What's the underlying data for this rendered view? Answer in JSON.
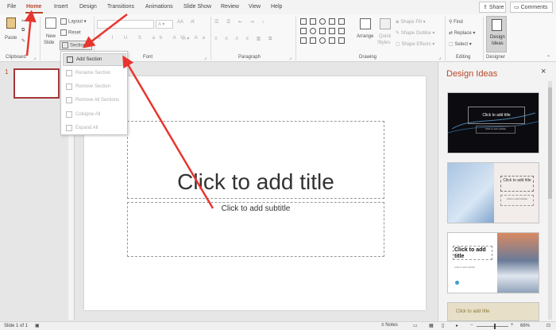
{
  "tabs": [
    "File",
    "Home",
    "Insert",
    "Design",
    "Transitions",
    "Animations",
    "Slide Show",
    "Review",
    "View",
    "Help"
  ],
  "header": {
    "share_label": "Share",
    "comments_label": "Comments"
  },
  "ribbon": {
    "clipboard": {
      "paste": "Paste",
      "label": "Clipboard"
    },
    "slides": {
      "new_slide": "New",
      "new_slide2": "Slide",
      "layout": "Layout",
      "reset": "Reset",
      "section": "Section"
    },
    "font": {
      "label": "Font",
      "size_hint": "AA"
    },
    "paragraph": {
      "label": "Paragraph"
    },
    "drawing": {
      "label": "Drawing",
      "arrange": "Arrange",
      "quick_styles": "Quick",
      "quick_styles2": "Styles",
      "shape_fill": "Shape Fill",
      "shape_outline": "Shape Outline",
      "shape_effects": "Shape Effects"
    },
    "editing": {
      "label": "Editing",
      "find": "Find",
      "replace": "Replace",
      "select": "Select"
    },
    "designer": {
      "label": "Designer",
      "design_ideas": "Design",
      "design_ideas2": "Ideas"
    }
  },
  "section_menu": {
    "items": [
      {
        "label": "Add Section",
        "enabled": true
      },
      {
        "label": "Rename Section",
        "enabled": false
      },
      {
        "label": "Remove Section",
        "enabled": false
      },
      {
        "label": "Remove All Sections",
        "enabled": false
      },
      {
        "label": "Collapse All",
        "enabled": false
      },
      {
        "label": "Expand All",
        "enabled": false
      }
    ]
  },
  "thumbnails": {
    "slide_number": "1"
  },
  "slide": {
    "title_placeholder": "Click to add title",
    "subtitle_placeholder": "Click to add subtitle"
  },
  "design_pane": {
    "title": "Design Ideas",
    "close": "×",
    "card1": {
      "title": "Click to add title",
      "sub": "Click to add subtitle"
    },
    "card2": {
      "title": "Click to add title",
      "sub": "Click to add subtitle"
    },
    "card3": {
      "title": "Click to add title",
      "sub": "Click to add subtitle"
    },
    "card4": {
      "title": "Click to add title"
    }
  },
  "status": {
    "slide_info": "Slide 1 of 1",
    "notes": "Notes",
    "zoom": "66%"
  },
  "colors": {
    "accent": "#b7472a",
    "arrow": "#e8352f",
    "thumb_border": "#a4373a"
  }
}
